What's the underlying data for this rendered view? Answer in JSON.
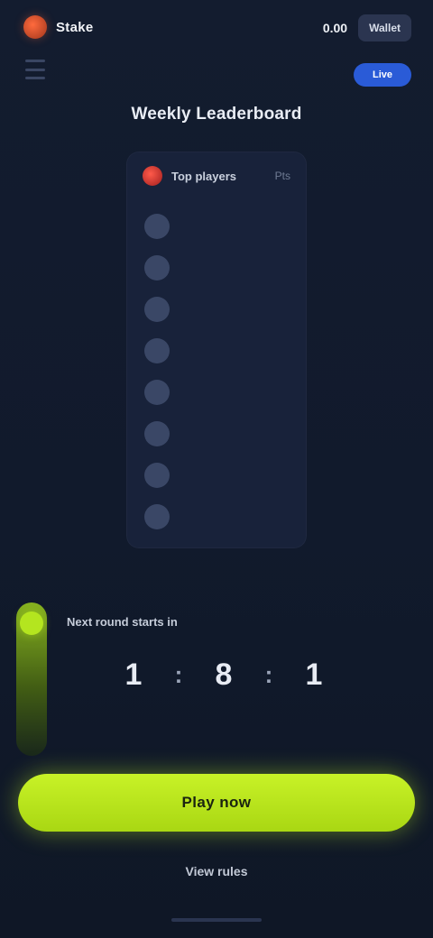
{
  "header": {
    "brand": "Stake",
    "balance": "0.00",
    "wallet_label": "Wallet",
    "pill_label": "Live"
  },
  "page": {
    "title": "Weekly Leaderboard"
  },
  "leaderboard": {
    "header_label": "Top players",
    "header_count": "Pts",
    "rows": [
      {
        "avatar": "",
        "name": "",
        "score": ""
      },
      {
        "avatar": "",
        "name": "",
        "score": ""
      },
      {
        "avatar": "",
        "name": "",
        "score": ""
      },
      {
        "avatar": "",
        "name": "",
        "score": ""
      },
      {
        "avatar": "",
        "name": "",
        "score": ""
      },
      {
        "avatar": "",
        "name": "",
        "score": ""
      },
      {
        "avatar": "",
        "name": "",
        "score": ""
      },
      {
        "avatar": "",
        "name": "",
        "score": ""
      }
    ]
  },
  "panel": {
    "title": "Next round starts in",
    "timer": {
      "d": "1",
      "h": "8",
      "m": "1"
    },
    "units": {
      "d": "",
      "h": "",
      "m": ""
    },
    "note": ""
  },
  "actions": {
    "cta_label": "Play now",
    "secondary_label": "View rules"
  },
  "colors": {
    "accent": "#b4e51f",
    "background": "#111a2c",
    "card": "#18223a",
    "pill": "#2a5bd7"
  }
}
